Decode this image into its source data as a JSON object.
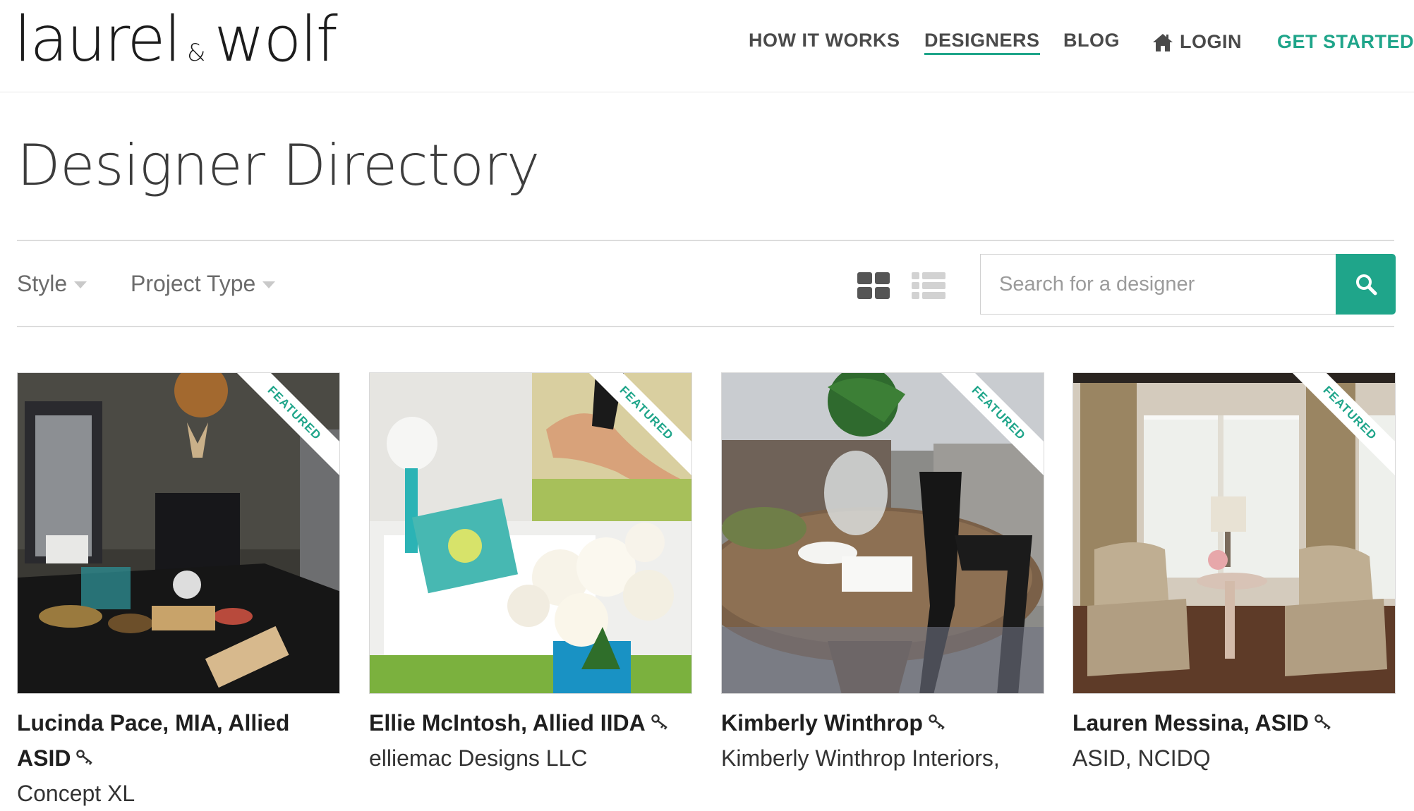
{
  "logo": {
    "part1": "laurel",
    "amp": "&",
    "part2": "wolf"
  },
  "nav": {
    "how_it_works": "HOW IT WORKS",
    "designers": "DESIGNERS",
    "blog": "BLOG",
    "login": "LOGIN",
    "get_started": "GET STARTED"
  },
  "page_title": "Designer Directory",
  "filters": {
    "style": "Style",
    "project_type": "Project Type"
  },
  "view_toggle": {
    "selected": "grid",
    "options": [
      "grid",
      "list"
    ]
  },
  "search": {
    "placeholder": "Search for a designer",
    "value": ""
  },
  "ribbon_label": "FEATURED",
  "designers": [
    {
      "name": "Lucinda Pace, MIA, Allied ASID",
      "company": "Concept XL",
      "featured": true,
      "photo": "dining-room"
    },
    {
      "name": "Ellie McIntosh, Allied IIDA",
      "company": "elliemac Designs LLC",
      "featured": true,
      "photo": "roses-sofa"
    },
    {
      "name": "Kimberly Winthrop",
      "company": "Kimberly Winthrop Interiors,",
      "featured": true,
      "photo": "round-table"
    },
    {
      "name": "Lauren Messina, ASID",
      "company": "ASID, NCIDQ",
      "featured": true,
      "photo": "armchairs"
    }
  ],
  "colors": {
    "accent": "#1fa58a",
    "text": "#333333",
    "muted": "#6b6b6b"
  },
  "icons": {
    "login": "home-icon",
    "search": "search-icon",
    "verified": "key-icon",
    "grid": "grid-view-icon",
    "list": "list-view-icon"
  }
}
